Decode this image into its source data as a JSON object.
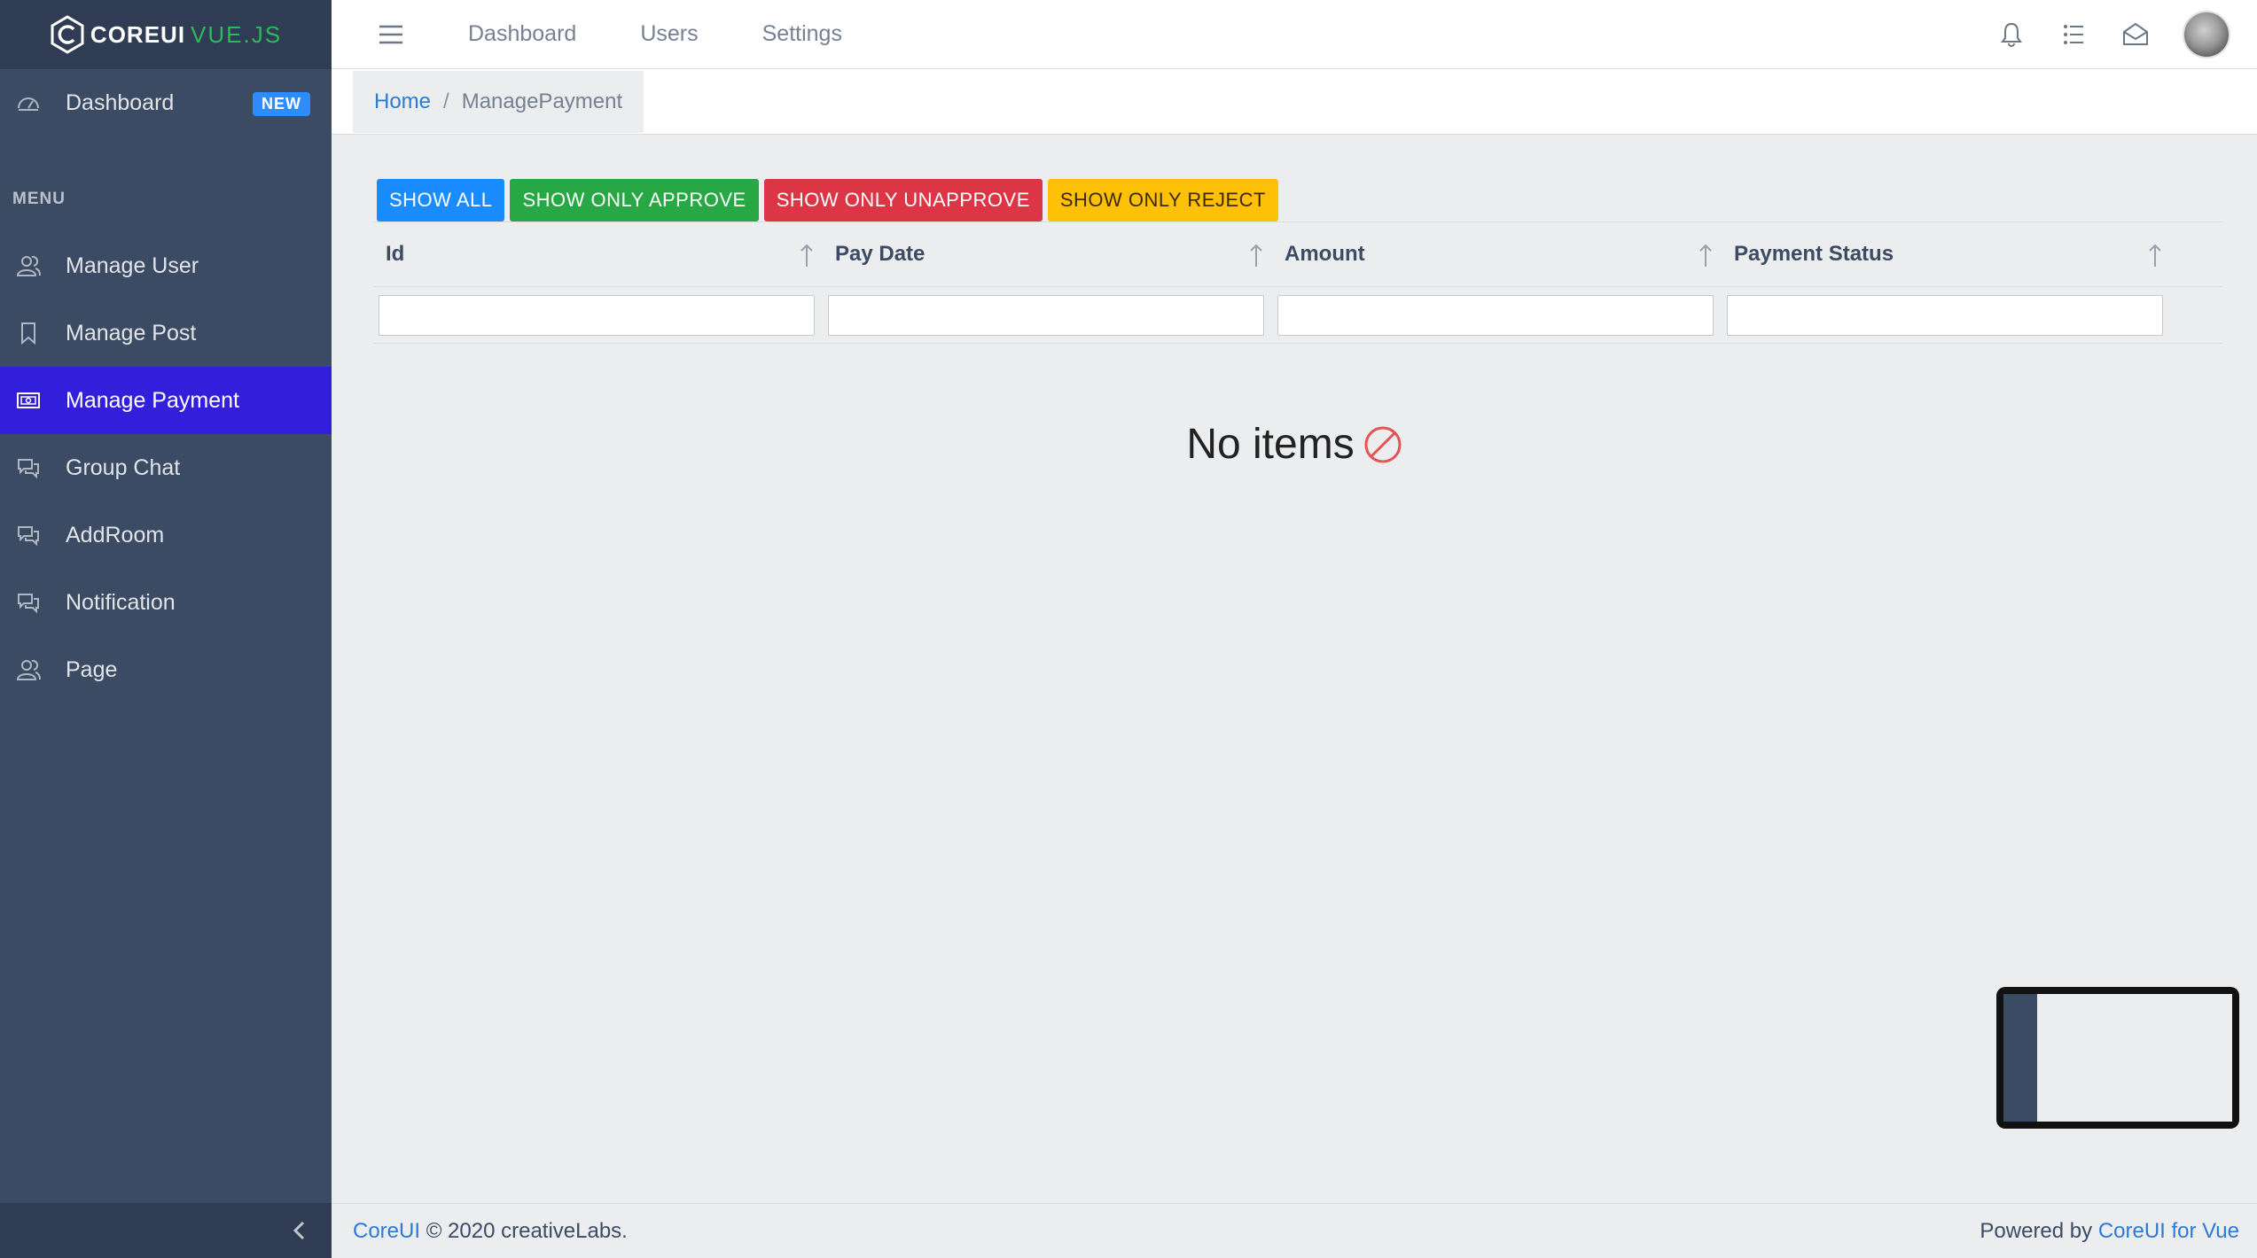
{
  "brand": {
    "core": "COREUI",
    "vue": "VUE.JS"
  },
  "sidebar": {
    "dashboard": {
      "label": "Dashboard",
      "badge": "NEW"
    },
    "menu_title": "MENU",
    "items": [
      {
        "label": "Manage User",
        "icon": "user-icon"
      },
      {
        "label": "Manage Post",
        "icon": "bookmark-icon"
      },
      {
        "label": "Manage Payment",
        "icon": "payment-icon",
        "active": true
      },
      {
        "label": "Group Chat",
        "icon": "chat-icon"
      },
      {
        "label": "AddRoom",
        "icon": "chat-icon"
      },
      {
        "label": "Notification",
        "icon": "chat-icon"
      },
      {
        "label": "Page",
        "icon": "user-icon"
      }
    ]
  },
  "header": {
    "nav": [
      "Dashboard",
      "Users",
      "Settings"
    ]
  },
  "breadcrumb": {
    "home": "Home",
    "current": "ManagePayment"
  },
  "filters": {
    "show_all": "SHOW ALL",
    "approve": "SHOW ONLY APPROVE",
    "unapprove": "SHOW ONLY UNAPPROVE",
    "reject": "SHOW ONLY REJECT"
  },
  "table": {
    "columns": [
      "Id",
      "Pay Date",
      "Amount",
      "Payment Status"
    ],
    "empty_text": "No items"
  },
  "footer": {
    "brand": "CoreUI",
    "copyright": "© 2020 creativeLabs.",
    "powered_by": "Powered by",
    "powered_link": "CoreUI for Vue"
  },
  "colors": {
    "sidebar_bg": "#3c4b64",
    "active": "#321fdb",
    "show_all": "#1a8cff",
    "approve": "#28a745",
    "unapprove": "#dc3545",
    "reject": "#ffc107"
  }
}
